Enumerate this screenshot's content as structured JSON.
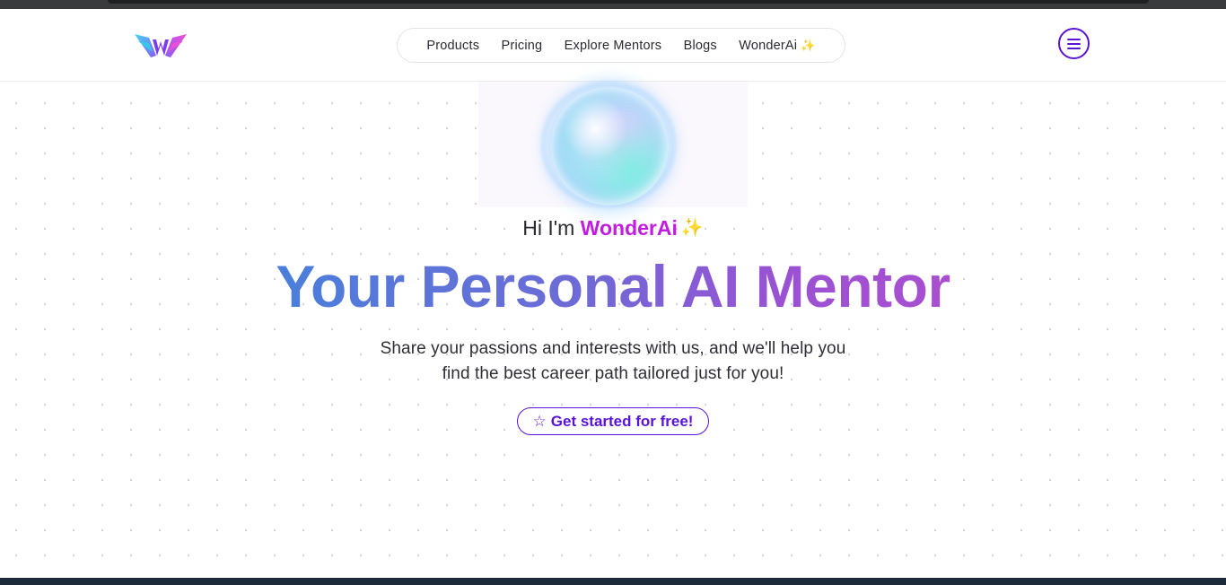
{
  "nav": {
    "logo_icon": "wonder-wings-logo-icon",
    "links": [
      {
        "label": "Products"
      },
      {
        "label": "Pricing"
      },
      {
        "label": "Explore Mentors"
      },
      {
        "label": "Blogs"
      },
      {
        "label": "WonderAi",
        "sparkle": "✨"
      }
    ],
    "menu_icon": "hamburger-menu-icon"
  },
  "hero": {
    "greeting_prefix": "Hi I'm ",
    "greeting_brand": "WonderAi",
    "greeting_sparkle": "✨",
    "headline": "Your Personal AI Mentor",
    "subtext_line1": "Share your passions and interests with us, and we'll help you",
    "subtext_line2": "find the best career path tailored just for you!",
    "cta_icon": "☆",
    "cta_label": "Get started for free!"
  },
  "colors": {
    "accent": "#5a13d6",
    "brand_text": "#c21ce0",
    "gradient_start": "#4a7fdb",
    "gradient_end": "#a94fd0"
  }
}
